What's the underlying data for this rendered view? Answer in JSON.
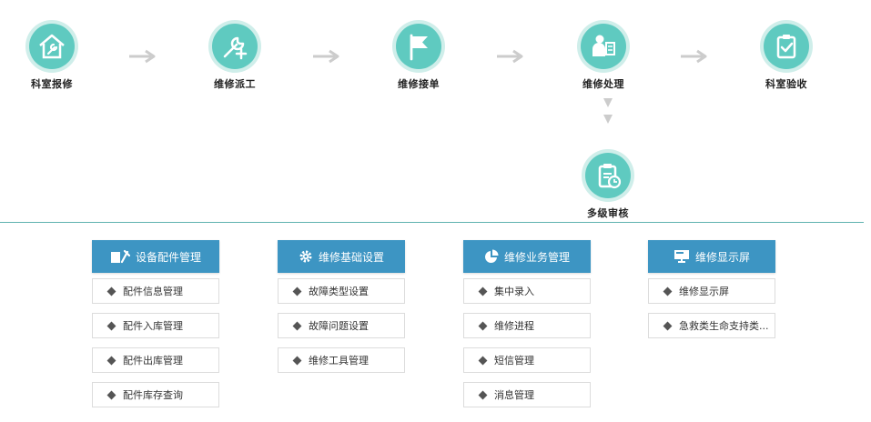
{
  "workflow": {
    "steps": [
      {
        "label": "科室报修",
        "icon": "house-wrench-icon"
      },
      {
        "label": "维修派工",
        "icon": "wrench-plus-icon"
      },
      {
        "label": "维修接单",
        "icon": "flag-icon"
      },
      {
        "label": "维修处理",
        "icon": "person-repair-icon"
      },
      {
        "label": "科室验收",
        "icon": "clipboard-check-icon"
      }
    ],
    "review": {
      "label": "多级审核",
      "icon": "clipboard-clock-icon"
    }
  },
  "modules": [
    {
      "title": "设备配件管理",
      "icon": "device-tool-icon",
      "items": [
        "配件信息管理",
        "配件入库管理",
        "配件出库管理",
        "配件库存查询"
      ]
    },
    {
      "title": "维修基础设置",
      "icon": "gear-icon",
      "items": [
        "故障类型设置",
        "故障问题设置",
        "维修工具管理"
      ]
    },
    {
      "title": "维修业务管理",
      "icon": "pie-chart-icon",
      "items": [
        "集中录入",
        "维修进程",
        "短信管理",
        "消息管理"
      ]
    },
    {
      "title": "维修显示屏",
      "icon": "monitor-icon",
      "items": [
        "维修显示屏",
        "急救类生命支持类..."
      ]
    }
  ],
  "colors": {
    "accent": "#5fcac0",
    "header_blue": "#3d95c3",
    "divider": "#5fb2b0",
    "arrow": "#cccccc"
  }
}
